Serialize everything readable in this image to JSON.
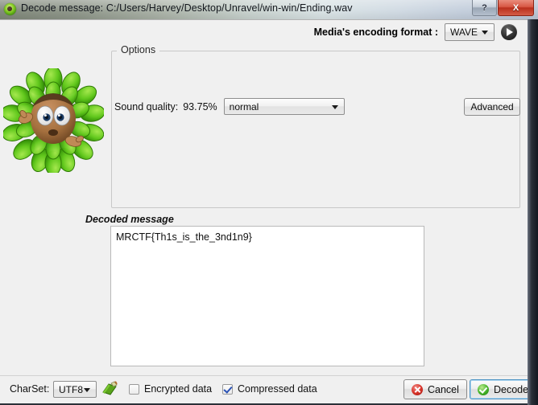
{
  "window": {
    "icon": "app-leaf-icon",
    "title": "Decode message: C:/Users/Harvey/Desktop/Unravel/win-win/Ending.wav",
    "help_button": "?",
    "close_button": "X"
  },
  "encoding": {
    "label": "Media's encoding format :",
    "format_value": "WAVE",
    "play_icon": "play-icon"
  },
  "options": {
    "group_title": "Options",
    "sound_quality_label": "Sound quality:",
    "sound_quality_percent": "93.75%",
    "quality_value": "normal",
    "advanced_label": "Advanced"
  },
  "mascot": {
    "name": "leaf-creature-mascot",
    "leaf_color": "#5fc21a",
    "leaf_dark": "#3e8f0c",
    "skin_color": "#b07a4e"
  },
  "decoded": {
    "label": "Decoded message",
    "text": "MRCTF{Th1s_is_the_3nd1n9}"
  },
  "bottom": {
    "charset_label": "CharSet:",
    "charset_value": "UTF8",
    "book_icon": "dictionary-book-icon",
    "encrypted_label": "Encrypted data",
    "encrypted_checked": false,
    "compressed_label": "Compressed data",
    "compressed_checked": true,
    "cancel_label": "Cancel",
    "decode_label": "Decode"
  },
  "colors": {
    "accent_blue": "#4c93c4",
    "cancel_red": "#d8342a",
    "decode_green": "#46b52a",
    "window_bg": "#f0f0f0"
  }
}
